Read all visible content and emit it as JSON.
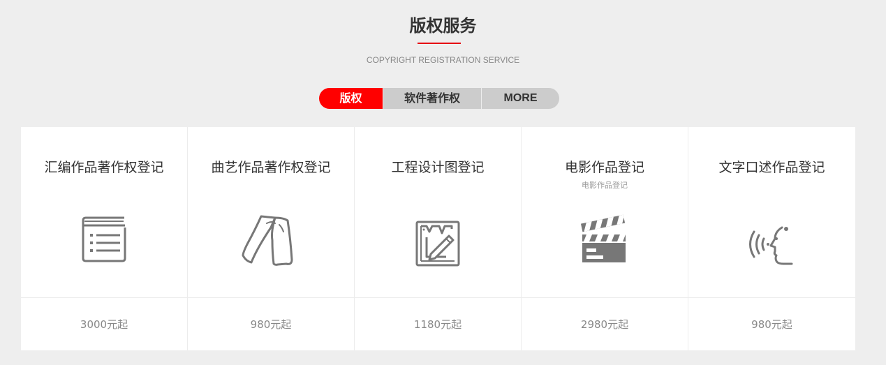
{
  "header": {
    "title": "版权服务",
    "subtitle": "COPYRIGHT REGISTRATION SERVICE",
    "accent_color": "#e60012"
  },
  "tabs": [
    {
      "label": "版权",
      "active": true
    },
    {
      "label": "软件著作权",
      "active": false
    },
    {
      "label": "MORE",
      "active": false
    }
  ],
  "cards": [
    {
      "title": "汇编作品著作权登记",
      "subtitle": "",
      "icon": "compilation-icon",
      "price": "3000元起"
    },
    {
      "title": "曲艺作品著作权登记",
      "subtitle": "",
      "icon": "folk-art-icon",
      "price": "980元起"
    },
    {
      "title": "工程设计图登记",
      "subtitle": "",
      "icon": "engineering-design-icon",
      "price": "1180元起"
    },
    {
      "title": "电影作品登记",
      "subtitle": "电影作品登记",
      "icon": "clapperboard-icon",
      "price": "2980元起"
    },
    {
      "title": "文字口述作品登记",
      "subtitle": "",
      "icon": "oral-speech-icon",
      "price": "980元起"
    }
  ]
}
